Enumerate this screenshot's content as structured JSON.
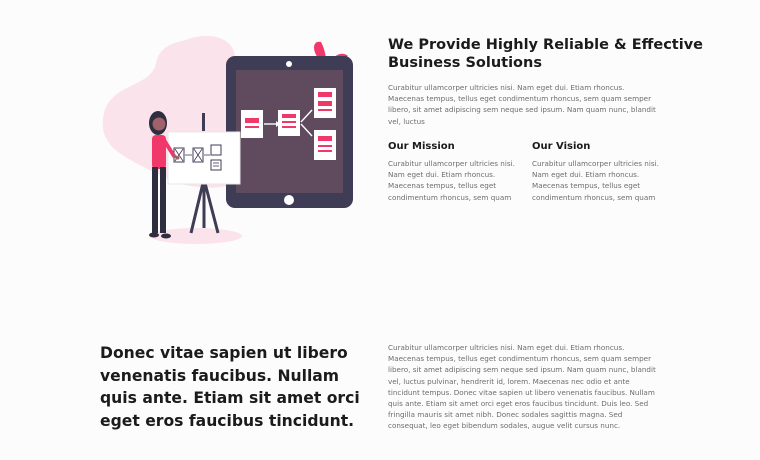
{
  "about": {
    "heading": "We Provide Highly Reliable & Effective Business Solutions",
    "intro": "Curabitur ullamcorper ultricies nisi. Nam eget dui. Etiam rhoncus. Maecenas tempus, tellus eget condimentum rhoncus, sem quam semper libero, sit amet adipiscing sem neque sed ipsum. Nam quam nunc, blandit vel, luctus",
    "mission": {
      "title": "Our Mission",
      "text": "Curabitur ullamcorper ultricies nisi. Nam eget dui. Etiam rhoncus. Maecenas tempus, tellus eget condimentum rhoncus, sem quam"
    },
    "vision": {
      "title": "Our Vision",
      "text": "Curabitur ullamcorper ultricies nisi. Nam eget dui. Etiam rhoncus. Maecenas tempus, tellus eget condimentum rhoncus, sem quam"
    }
  },
  "feature": {
    "heading": "Donec vitae sapien ut libero venenatis faucibus. Nullam quis ante. Etiam sit amet orci eget eros faucibus tincidunt.",
    "text": "Curabitur ullamcorper ultricies nisi. Nam eget dui. Etiam rhoncus. Maecenas tempus, tellus eget condimentum rhoncus, sem quam semper libero, sit amet adipiscing sem neque sed ipsum. Nam quam nunc, blandit vel, luctus pulvinar, hendrerit id, lorem. Maecenas nec odio et ante tincidunt tempus. Donec vitae sapien ut libero venenatis faucibus. Nullam quis ante. Etiam sit amet orci eget eros faucibus tincidunt. Duis leo. Sed fringilla mauris sit amet nibh. Donec sodales sagittis magna. Sed consequat, leo eget bibendum sodales, augue velit cursus nunc."
  },
  "colors": {
    "accent": "#f0386b",
    "tablet_frame": "#3f3d56",
    "tablet_screen": "#5f4a5e",
    "blob": "#fbe3eb",
    "heading_text": "#1b1b1b",
    "body_text": "#6d6d6d"
  },
  "icons": [
    "business-presentation-illustration",
    "tablet-icon",
    "flowchart-icon",
    "easel-icon"
  ]
}
